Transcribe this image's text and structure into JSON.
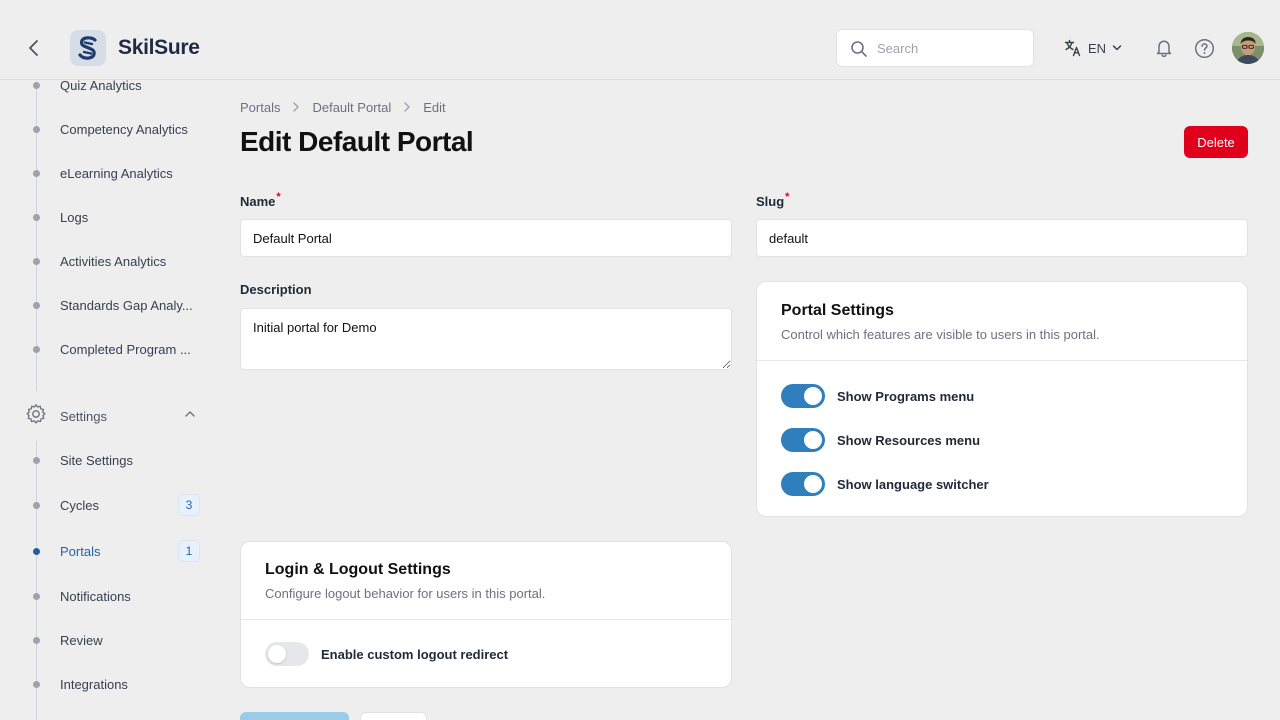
{
  "header": {
    "brand": "SkilSure",
    "search_placeholder": "Search",
    "language": "EN"
  },
  "sidebar": {
    "items_top": [
      {
        "label": "Quiz Analytics"
      },
      {
        "label": "Competency Analytics"
      },
      {
        "label": "eLearning Analytics"
      },
      {
        "label": "Logs"
      },
      {
        "label": "Activities Analytics"
      },
      {
        "label": "Standards Gap Analy..."
      },
      {
        "label": "Completed Program ..."
      }
    ],
    "settings_label": "Settings",
    "items_settings": [
      {
        "label": "Site Settings"
      },
      {
        "label": "Cycles",
        "badge": "3"
      },
      {
        "label": "Portals",
        "badge": "1"
      },
      {
        "label": "Notifications"
      },
      {
        "label": "Review"
      },
      {
        "label": "Integrations"
      }
    ]
  },
  "breadcrumb": [
    "Portals",
    "Default Portal",
    "Edit"
  ],
  "page": {
    "title": "Edit Default Portal",
    "delete_label": "Delete"
  },
  "form": {
    "name_label": "Name",
    "name_value": "Default Portal",
    "slug_label": "Slug",
    "slug_value": "default",
    "description_label": "Description",
    "description_value": "Initial portal for Demo",
    "required_mark": "*"
  },
  "portal_settings": {
    "title": "Portal Settings",
    "subtitle": "Control which features are visible to users in this portal.",
    "toggles": [
      {
        "label": "Show Programs menu",
        "on": true
      },
      {
        "label": "Show Resources menu",
        "on": true
      },
      {
        "label": "Show language switcher",
        "on": true
      }
    ]
  },
  "login_settings": {
    "title": "Login & Logout Settings",
    "subtitle": "Configure logout behavior for users in this portal.",
    "toggle_label": "Enable custom logout redirect",
    "toggle_on": false
  },
  "colors": {
    "accent": "#2f7fbd",
    "danger": "#e0001b",
    "active_nav": "#2563a8"
  }
}
